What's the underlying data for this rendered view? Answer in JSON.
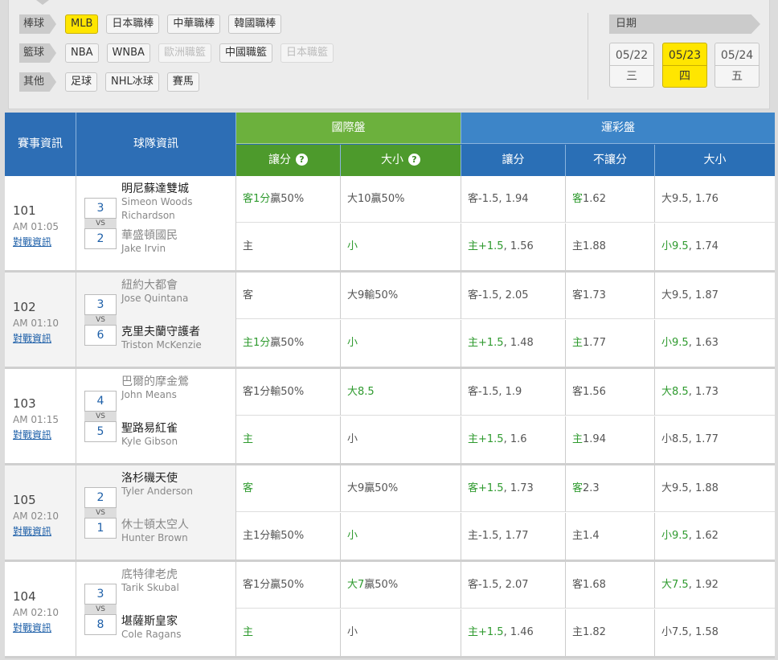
{
  "sports": [
    {
      "tag": "棒球",
      "items": [
        {
          "label": "MLB",
          "state": "active"
        },
        {
          "label": "日本職棒",
          "state": "normal"
        },
        {
          "label": "中華職棒",
          "state": "normal"
        },
        {
          "label": "韓國職棒",
          "state": "normal"
        }
      ]
    },
    {
      "tag": "籃球",
      "items": [
        {
          "label": "NBA",
          "state": "normal"
        },
        {
          "label": "WNBA",
          "state": "normal"
        },
        {
          "label": "歐洲職籃",
          "state": "disabled"
        },
        {
          "label": "中國職籃",
          "state": "normal"
        },
        {
          "label": "日本職籃",
          "state": "disabled"
        }
      ]
    },
    {
      "tag": "其他",
      "items": [
        {
          "label": "足球",
          "state": "normal"
        },
        {
          "label": "NHL冰球",
          "state": "normal"
        },
        {
          "label": "賽馬",
          "state": "normal"
        }
      ]
    }
  ],
  "date": {
    "label": "日期",
    "options": [
      {
        "date": "05/22",
        "weekday": "三",
        "active": false
      },
      {
        "date": "05/23",
        "weekday": "四",
        "active": true
      },
      {
        "date": "05/24",
        "weekday": "五",
        "active": false
      }
    ]
  },
  "header": {
    "match_info": "賽事資訊",
    "team_info": "球隊資訊",
    "intl": "國際盤",
    "lottery": "運彩盤",
    "intl_handicap": "讓分",
    "intl_total": "大小",
    "lot_handicap": "讓分",
    "lot_moneyline": "不讓分",
    "lot_total": "大小",
    "help_icon": "?"
  },
  "matches": [
    {
      "num": "101",
      "time": "AM 01:05",
      "link": "對戰資訊",
      "away": {
        "team": "明尼蘇達雙城",
        "pitcher": "Simeon Woods Richardson",
        "score": "3",
        "strong": true
      },
      "home": {
        "team": "華盛頓國民",
        "pitcher": "Jake Irvin",
        "score": "2",
        "strong": false
      },
      "rows": [
        {
          "ih": {
            "g": "客1分",
            "t": "贏50%"
          },
          "it": {
            "g": "",
            "t": "大10贏50%"
          },
          "lh": {
            "g": "",
            "t": "客-1.5, 1.94"
          },
          "lm": {
            "g": "客",
            "t": "1.62"
          },
          "lt": {
            "g": "",
            "t": "大9.5, 1.76"
          }
        },
        {
          "ih": {
            "g": "",
            "t": "主"
          },
          "it": {
            "g": "小",
            "t": ""
          },
          "lh": {
            "g": "主+1.5",
            "t": ", 1.56"
          },
          "lm": {
            "g": "",
            "t": "主1.88"
          },
          "lt": {
            "g": "小9.5",
            "t": ", 1.74"
          }
        }
      ]
    },
    {
      "num": "102",
      "time": "AM 01:10",
      "link": "對戰資訊",
      "away": {
        "team": "紐約大都會",
        "pitcher": "Jose Quintana",
        "score": "3",
        "strong": false
      },
      "home": {
        "team": "克里夫蘭守護者",
        "pitcher": "Triston McKenzie",
        "score": "6",
        "strong": true
      },
      "rows": [
        {
          "ih": {
            "g": "",
            "t": "客"
          },
          "it": {
            "g": "",
            "t": "大9輸50%"
          },
          "lh": {
            "g": "",
            "t": "客-1.5, 2.05"
          },
          "lm": {
            "g": "",
            "t": "客1.73"
          },
          "lt": {
            "g": "",
            "t": "大9.5, 1.87"
          }
        },
        {
          "ih": {
            "g": "主1分",
            "t": "贏50%"
          },
          "it": {
            "g": "小",
            "t": ""
          },
          "lh": {
            "g": "主+1.5",
            "t": ", 1.48"
          },
          "lm": {
            "g": "主",
            "t": "1.77"
          },
          "lt": {
            "g": "小9.5",
            "t": ", 1.63"
          }
        }
      ]
    },
    {
      "num": "103",
      "time": "AM 01:15",
      "link": "對戰資訊",
      "away": {
        "team": "巴爾的摩金鶯",
        "pitcher": "John Means",
        "score": "4",
        "strong": false
      },
      "home": {
        "team": "聖路易紅雀",
        "pitcher": "Kyle Gibson",
        "score": "5",
        "strong": true
      },
      "rows": [
        {
          "ih": {
            "g": "",
            "t": "客1分輸50%"
          },
          "it": {
            "g": "大8.5",
            "t": ""
          },
          "lh": {
            "g": "",
            "t": "客-1.5, 1.9"
          },
          "lm": {
            "g": "",
            "t": "客1.56"
          },
          "lt": {
            "g": "大8.5",
            "t": ", 1.73"
          }
        },
        {
          "ih": {
            "g": "主",
            "t": ""
          },
          "it": {
            "g": "",
            "t": "小"
          },
          "lh": {
            "g": "主+1.5",
            "t": ", 1.6"
          },
          "lm": {
            "g": "主",
            "t": "1.94"
          },
          "lt": {
            "g": "",
            "t": "小8.5, 1.77"
          }
        }
      ]
    },
    {
      "num": "105",
      "time": "AM 02:10",
      "link": "對戰資訊",
      "away": {
        "team": "洛杉磯天使",
        "pitcher": "Tyler Anderson",
        "score": "2",
        "strong": true
      },
      "home": {
        "team": "休士頓太空人",
        "pitcher": "Hunter Brown",
        "score": "1",
        "strong": false
      },
      "rows": [
        {
          "ih": {
            "g": "客",
            "t": ""
          },
          "it": {
            "g": "",
            "t": "大9贏50%"
          },
          "lh": {
            "g": "客+1.5",
            "t": ", 1.73"
          },
          "lm": {
            "g": "客",
            "t": "2.3"
          },
          "lt": {
            "g": "",
            "t": "大9.5, 1.88"
          }
        },
        {
          "ih": {
            "g": "",
            "t": "主1分輸50%"
          },
          "it": {
            "g": "小",
            "t": ""
          },
          "lh": {
            "g": "",
            "t": "主-1.5, 1.77"
          },
          "lm": {
            "g": "",
            "t": "主1.4"
          },
          "lt": {
            "g": "小9.5",
            "t": ", 1.62"
          }
        }
      ]
    },
    {
      "num": "104",
      "time": "AM 02:10",
      "link": "對戰資訊",
      "away": {
        "team": "底特律老虎",
        "pitcher": "Tarik Skubal",
        "score": "3",
        "strong": false
      },
      "home": {
        "team": "堪薩斯皇家",
        "pitcher": "Cole Ragans",
        "score": "8",
        "strong": true
      },
      "rows": [
        {
          "ih": {
            "g": "",
            "t": "客1分贏50%"
          },
          "it": {
            "g": "大7",
            "t": "贏50%"
          },
          "lh": {
            "g": "",
            "t": "客-1.5, 2.07"
          },
          "lm": {
            "g": "",
            "t": "客1.68"
          },
          "lt": {
            "g": "大7.5",
            "t": ", 1.92"
          }
        },
        {
          "ih": {
            "g": "主",
            "t": ""
          },
          "it": {
            "g": "",
            "t": "小"
          },
          "lh": {
            "g": "主+1.5",
            "t": ", 1.46"
          },
          "lm": {
            "g": "",
            "t": "主1.82"
          },
          "lt": {
            "g": "",
            "t": "小7.5, 1.58"
          }
        }
      ]
    }
  ]
}
